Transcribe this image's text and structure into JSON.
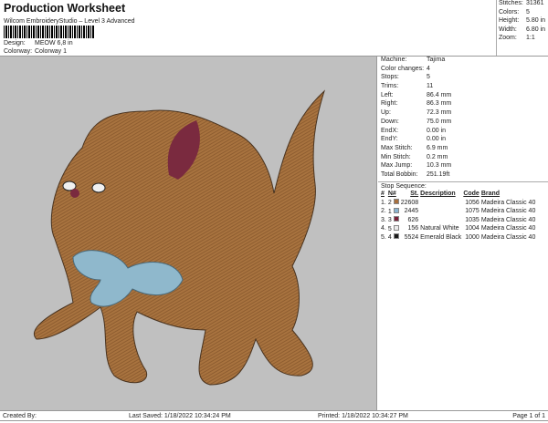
{
  "header": {
    "title": "Production Worksheet",
    "subtitle": "Wilcom EmbroideryStudio – Level 3 Advanced",
    "design_label": "Design:",
    "design_value": "MEOW 6,8 in",
    "colorway_label": "Colorway:",
    "colorway_value": "Colorway 1"
  },
  "stats": [
    {
      "label": "Stitches:",
      "value": "31361"
    },
    {
      "label": "Colors:",
      "value": "5"
    },
    {
      "label": "Height:",
      "value": "5.80 in"
    },
    {
      "label": "Width:",
      "value": "6.80 in"
    },
    {
      "label": "Zoom:",
      "value": "1:1"
    }
  ],
  "details": [
    {
      "label": "Machine:",
      "value": "Tajima"
    },
    {
      "label": "Color changes:",
      "value": "4"
    },
    {
      "label": "Stops:",
      "value": "5"
    },
    {
      "label": "Trims:",
      "value": "11"
    },
    {
      "label": "Left:",
      "value": "86.4 mm"
    },
    {
      "label": "Right:",
      "value": "86.3 mm"
    },
    {
      "label": "Up:",
      "value": "72.3 mm"
    },
    {
      "label": "Down:",
      "value": "75.0 mm"
    },
    {
      "label": "EndX:",
      "value": "0.00 in"
    },
    {
      "label": "EndY:",
      "value": "0.00 in"
    },
    {
      "label": "Max Stitch:",
      "value": "6.9 mm"
    },
    {
      "label": "Min Stitch:",
      "value": "0.2 mm"
    },
    {
      "label": "Max Jump:",
      "value": "10.3 mm"
    },
    {
      "label": "Total Bobbin:",
      "value": "251.19ft"
    }
  ],
  "stop_sequence": {
    "title": "Stop Sequence:",
    "headers": [
      "#",
      "N#",
      "St.",
      "Description",
      "Code",
      "Brand"
    ],
    "rows": [
      {
        "idx": "1.",
        "n": "2",
        "color": "#a8703f",
        "st": "22608",
        "desc": "",
        "code": "1056",
        "brand": "Madeira Classic 40"
      },
      {
        "idx": "2.",
        "n": "1",
        "color": "#8ab4d0",
        "st": "2445",
        "desc": "",
        "code": "1075",
        "brand": "Madeira Classic 40"
      },
      {
        "idx": "3.",
        "n": "3",
        "color": "#7a2038",
        "st": "626",
        "desc": "",
        "code": "1035",
        "brand": "Madeira Classic 40"
      },
      {
        "idx": "4.",
        "n": "5",
        "color": "#ececec",
        "st": "156",
        "desc": "Natural White",
        "code": "1004",
        "brand": "Madeira Classic 40"
      },
      {
        "idx": "5.",
        "n": "4",
        "color": "#1a1a1a",
        "st": "5524",
        "desc": "Emerald Black",
        "code": "1000",
        "brand": "Madeira Classic 40"
      }
    ]
  },
  "footer": {
    "created": "Created By:",
    "saved": "Last Saved: 1/18/2022 10:34:24 PM",
    "printed": "Printed: 1/18/2022 10:34:27 PM",
    "page": "Page 1 of 1"
  }
}
